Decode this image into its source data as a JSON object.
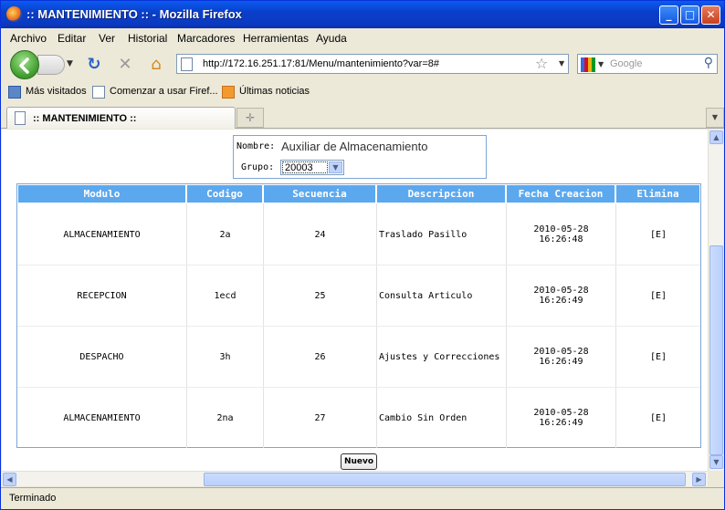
{
  "window": {
    "title": ":: MANTENIMIENTO :: - Mozilla Firefox",
    "buttons": {
      "minimize": "_",
      "maximize": "□",
      "close": "✕"
    }
  },
  "menu": [
    "Archivo",
    "Editar",
    "Ver",
    "Historial",
    "Marcadores",
    "Herramientas",
    "Ayuda"
  ],
  "nav": {
    "url": "http://172.16.251.17:81/Menu/mantenimiento?var=8#",
    "search_placeholder": "Google"
  },
  "bookmarks": [
    "Más visitados",
    "Comenzar a usar Firef...",
    "Últimas noticias"
  ],
  "tab": {
    "label": ":: MANTENIMIENTO ::"
  },
  "page": {
    "nombre_label": "Nombre:",
    "nombre_value": "Auxiliar de Almacenamiento",
    "grupo_label": "Grupo:",
    "grupo_value": "20003",
    "nuevo_label": "Nuevo"
  },
  "table": {
    "headers": [
      "Modulo",
      "Codigo",
      "Secuencia",
      "Descripcion",
      "Fecha Creacion",
      "Elimina"
    ],
    "rows": [
      {
        "modulo": "ALMACENAMIENTO",
        "codigo": "2a",
        "secuencia": "24",
        "descripcion": "Traslado Pasillo",
        "fecha": "2010-05-28",
        "hora": "16:26:48",
        "elimina": "[E]"
      },
      {
        "modulo": "RECEPCION",
        "codigo": "1ecd",
        "secuencia": "25",
        "descripcion": "Consulta Articulo",
        "fecha": "2010-05-28",
        "hora": "16:26:49",
        "elimina": "[E]"
      },
      {
        "modulo": "DESPACHO",
        "codigo": "3h",
        "secuencia": "26",
        "descripcion": "Ajustes y Correcciones",
        "fecha": "2010-05-28",
        "hora": "16:26:49",
        "elimina": "[E]"
      },
      {
        "modulo": "ALMACENAMIENTO",
        "codigo": "2na",
        "secuencia": "27",
        "descripcion": "Cambio Sin Orden",
        "fecha": "2010-05-28",
        "hora": "16:26:49",
        "elimina": "[E]"
      }
    ]
  },
  "status": "Terminado"
}
